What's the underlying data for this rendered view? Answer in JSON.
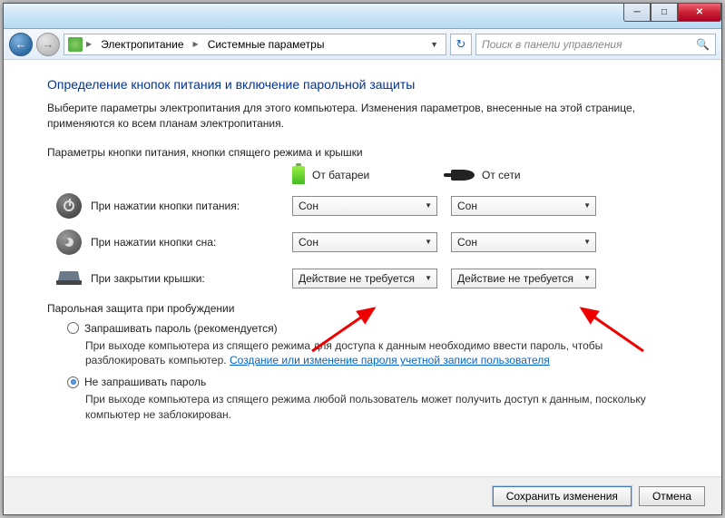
{
  "breadcrumb": {
    "item1": "Электропитание",
    "item2": "Системные параметры"
  },
  "search": {
    "placeholder": "Поиск в панели управления"
  },
  "heading": "Определение кнопок питания и включение парольной защиты",
  "description": "Выберите параметры электропитания для этого компьютера. Изменения параметров, внесенные на этой странице, применяются ко всем планам электропитания.",
  "section1_label": "Параметры кнопки питания, кнопки спящего режима и крышки",
  "cols": {
    "battery": "От батареи",
    "plugged": "От сети"
  },
  "rows": {
    "power": {
      "label": "При нажатии кнопки питания:",
      "bat": "Сон",
      "ac": "Сон"
    },
    "sleep": {
      "label": "При нажатии кнопки сна:",
      "bat": "Сон",
      "ac": "Сон"
    },
    "lid": {
      "label": "При закрытии крышки:",
      "bat": "Действие не требуется",
      "ac": "Действие не требуется"
    }
  },
  "section2_label": "Парольная защита при пробуждении",
  "opt1": {
    "label": "Запрашивать пароль (рекомендуется)",
    "desc_a": "При выходе компьютера из спящего режима для доступа к данным необходимо ввести пароль, чтобы разблокировать компьютер. ",
    "link": "Создание или изменение пароля учетной записи пользователя"
  },
  "opt2": {
    "label": "Не запрашивать пароль",
    "desc": "При выходе компьютера из спящего режима любой пользователь может получить доступ к данным, поскольку компьютер не заблокирован."
  },
  "buttons": {
    "save": "Сохранить изменения",
    "cancel": "Отмена"
  }
}
